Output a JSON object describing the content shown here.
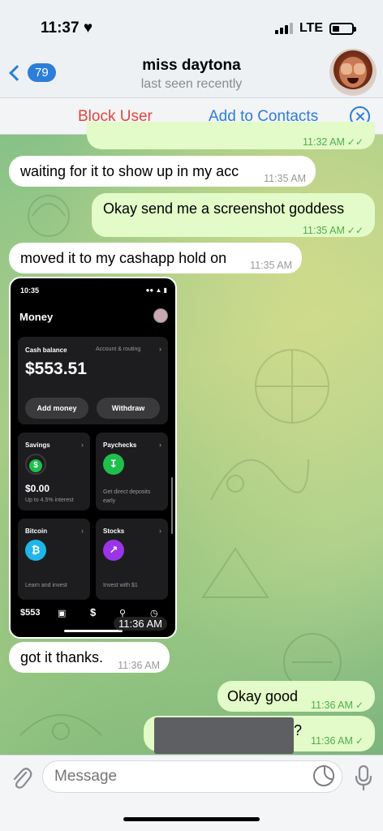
{
  "status_bar": {
    "time": "11:37",
    "network": "LTE"
  },
  "header": {
    "back_count": "79",
    "title": "miss daytona",
    "subtitle": "last seen recently"
  },
  "action_bar": {
    "block_label": "Block User",
    "add_label": "Add to Contacts"
  },
  "messages": [
    {
      "dir": "out",
      "text": "",
      "time": "11:32 AM",
      "read": true
    },
    {
      "dir": "in",
      "text": "waiting for it to show up in my acc",
      "time": "11:35 AM"
    },
    {
      "dir": "out",
      "text": "Okay send me a screenshot goddess",
      "time": "11:35 AM",
      "read": true
    },
    {
      "dir": "in",
      "text": "moved it to my cashapp hold on",
      "time": "11:35 AM"
    },
    {
      "dir": "in",
      "type": "image",
      "time": "11:36 AM"
    },
    {
      "dir": "in",
      "text": "got it thanks.",
      "time": "11:36 AM"
    },
    {
      "dir": "out",
      "text": "Okay good",
      "time": "11:36 AM",
      "read": false
    },
    {
      "dir": "out",
      "text": "?",
      "time": "11:36 AM",
      "read": false
    }
  ],
  "screenshot": {
    "time": "10:35",
    "title": "Money",
    "cash_balance_label": "Cash balance",
    "account_routing": "Account & routing",
    "balance": "$553.51",
    "add_money": "Add money",
    "withdraw": "Withdraw",
    "savings_label": "Savings",
    "savings_value": "$0.00",
    "savings_note": "Up to 4.5% interest",
    "paychecks_label": "Paychecks",
    "paychecks_note": "Get direct deposits early",
    "bitcoin_label": "Bitcoin",
    "bitcoin_note": "Learn and invest",
    "stocks_label": "Stocks",
    "stocks_note": "Invest with $1",
    "nav_balance": "$553",
    "nav_dollar": "$"
  },
  "input": {
    "placeholder": "Message"
  },
  "colors": {
    "accent": "#2b7ed9",
    "danger": "#e0463e",
    "outgoing": "#e2fbc8",
    "read_check": "#4fae4e"
  }
}
